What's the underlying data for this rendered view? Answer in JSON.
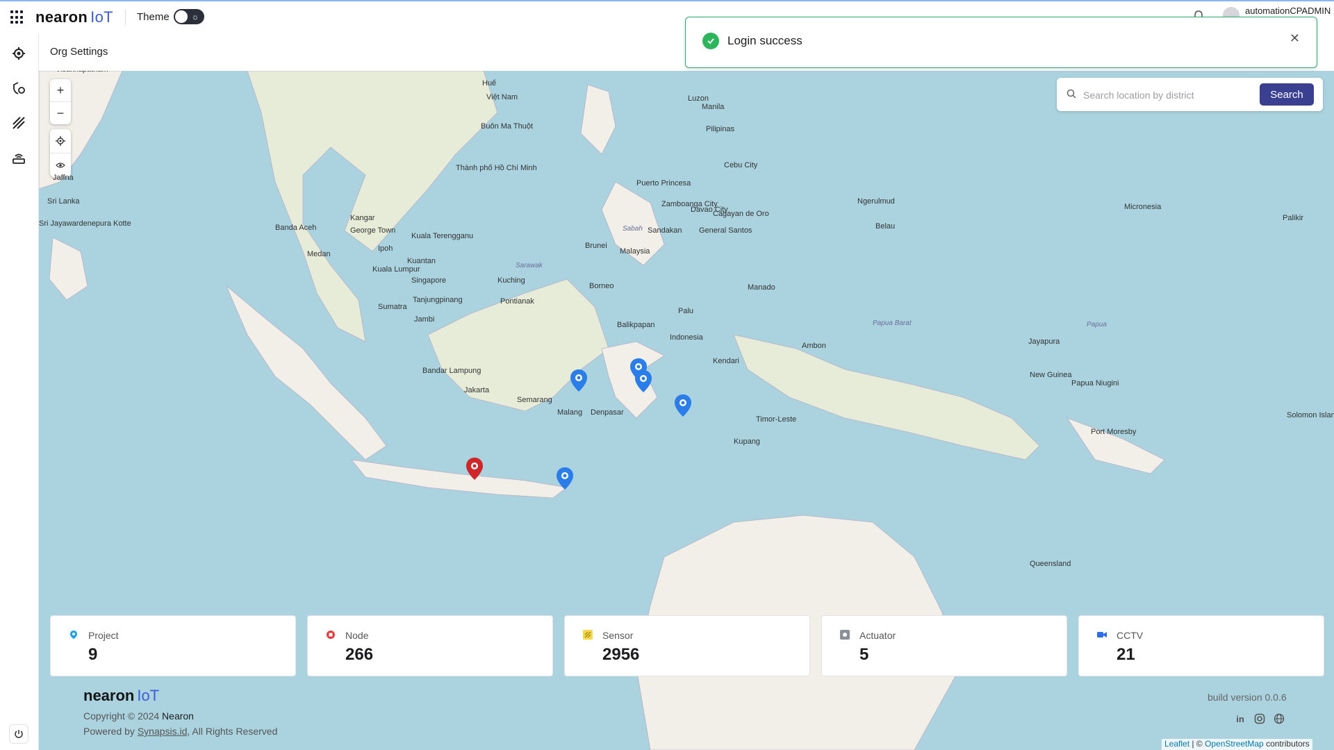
{
  "brand": {
    "name": "nearon",
    "suffix": "IoT"
  },
  "topbar": {
    "theme_label": "Theme",
    "username": "automationCPADMIN"
  },
  "page": {
    "title": "Org Settings"
  },
  "search": {
    "placeholder": "Search location by district",
    "button_label": "Search"
  },
  "toast": {
    "message": "Login success",
    "status_color": "#2db55d"
  },
  "map_labels": [
    "Visakhapatnam",
    "Jaffna",
    "Sri Lanka",
    "Sri Jayawardenepura Kotte",
    "Banda Aceh",
    "Medan",
    "Kangar",
    "George Town",
    "Ipoh",
    "Kuala Terengganu",
    "Kuantan",
    "Kuala Lumpur",
    "Singapore",
    "Tanjungpinang",
    "Sumatra",
    "Jambi",
    "Bandar Lampung",
    "Jakarta",
    "Semarang",
    "Malang",
    "Denpasar",
    "Pontianak",
    "Kuching",
    "Borneo",
    "Brunei",
    "Malaysia",
    "Sandakan",
    "Balikpapan",
    "Palu",
    "Indonesia",
    "Manado",
    "Kendari",
    "Ambon",
    "Puerto Princesa",
    "Zamboanga City",
    "Davao City",
    "General Santos",
    "Cebu City",
    "Cagayan de Oro",
    "Luzon",
    "Manila",
    "Pilipinas",
    "Huế",
    "Việt Nam",
    "Buôn Ma Thuột",
    "Thành phố Hồ Chí Minh",
    "Ngerulmud",
    "Belau",
    "Micronesia",
    "Palikir",
    "Jayapura",
    "New Guinea",
    "Papua Niugini",
    "Port Moresby",
    "Timor-Leste",
    "Kupang",
    "Solomon Islands",
    "Queensland",
    "Sabah",
    "Sarawak",
    "Papua",
    "Papua Barat"
  ],
  "stats": [
    {
      "label": "Project",
      "value": "9",
      "icon": "location-pin-icon",
      "color": "#1aa3e8"
    },
    {
      "label": "Node",
      "value": "266",
      "icon": "node-icon",
      "color": "#e23b3b"
    },
    {
      "label": "Sensor",
      "value": "2956",
      "icon": "sensor-icon",
      "color": "#e8c21a"
    },
    {
      "label": "Actuator",
      "value": "5",
      "icon": "actuator-icon",
      "color": "#8a8f99"
    },
    {
      "label": "CCTV",
      "value": "21",
      "icon": "camera-icon",
      "color": "#2b6de8"
    }
  ],
  "footer": {
    "copyright_prefix": "Copyright © 2024",
    "company": "Nearon",
    "powered_prefix": "Powered by",
    "powered_link": "Synapsis.id",
    "powered_suffix": ", All Rights Reserved",
    "build": "build version 0.0.6"
  },
  "attribution": {
    "leaflet": "Leaflet",
    "sep": "| ©",
    "osm": "OpenStreetMap",
    "suffix": "contributors"
  },
  "colors": {
    "accent": "#3b3f8f",
    "brand_iot": "#3e5bd8",
    "pin_blue": "#2b7de9",
    "pin_red": "#d0262a",
    "water": "#aad3df",
    "land": "#f2efe9"
  }
}
